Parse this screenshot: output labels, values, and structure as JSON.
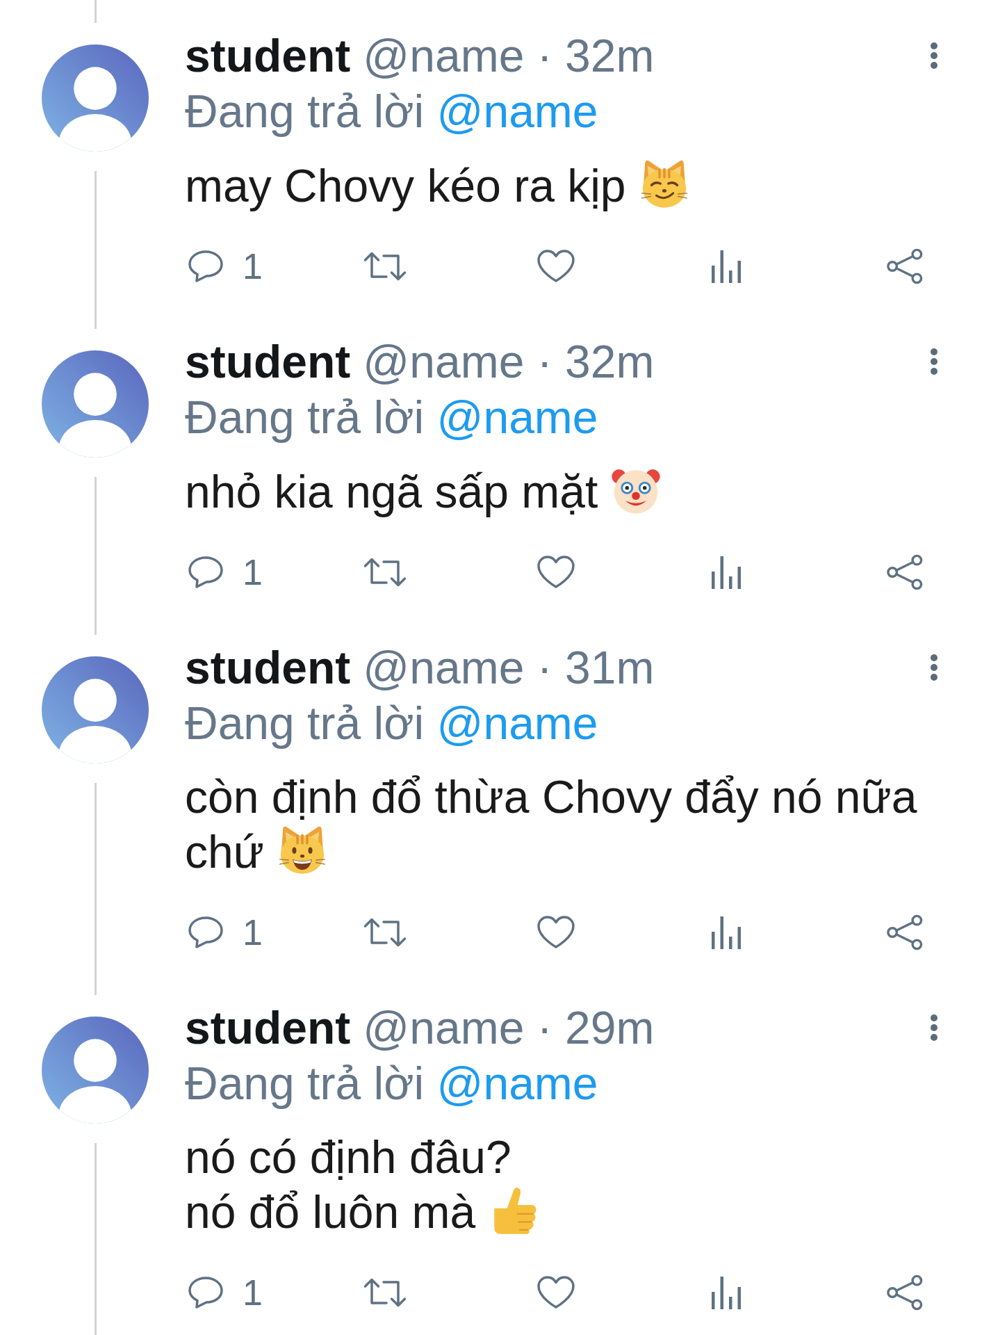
{
  "thread": {
    "posts": [
      {
        "name": "student",
        "meta": "@name · 32m",
        "reply_prefix": "Đang trả lời",
        "reply_to": "@name",
        "lines": [
          "may Chovy kéo ra kịp"
        ],
        "emoji": {
          "kind": "smirking_cat"
        },
        "reply_count": "1",
        "liked": false
      },
      {
        "name": "student",
        "meta": "@name · 32m",
        "reply_prefix": "Đang trả lời",
        "reply_to": "@name",
        "lines": [
          "nhỏ kia ngã sấp mặt"
        ],
        "emoji": {
          "kind": "clown"
        },
        "reply_count": "1",
        "liked": false
      },
      {
        "name": "student",
        "meta": "@name · 31m",
        "reply_prefix": "Đang trả lời",
        "reply_to": "@name",
        "lines": [
          "còn định đổ thừa Chovy đẩy nó nữa",
          "chứ"
        ],
        "emoji": {
          "kind": "grinning_cat"
        },
        "reply_count": "1",
        "liked": false
      },
      {
        "name": "student",
        "meta": "@name · 29m",
        "reply_prefix": "Đang trả lời",
        "reply_to": "@name",
        "lines": [
          "nó có định đâu?",
          "nó đổ luôn mà"
        ],
        "emoji": {
          "kind": "thumbs_up"
        },
        "reply_count": "1",
        "liked": false
      }
    ]
  }
}
